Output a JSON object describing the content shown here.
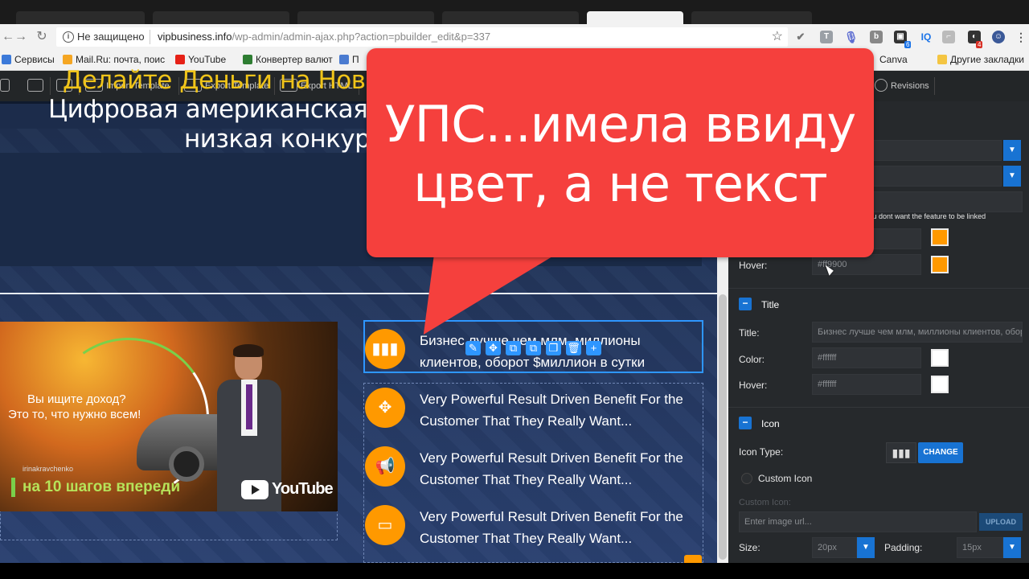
{
  "browser": {
    "security_label": "Не защищено",
    "url_domain": "vipbusiness.info",
    "url_path": "/wp-admin/admin-ajax.php?action=pbuilder_edit&p=337",
    "bookmarks": [
      "Сервисы",
      "Mail.Ru: почта, поис",
      "YouTube",
      "Конвертер валют",
      "П",
      "Canva",
      "Другие закладки"
    ],
    "badges": {
      "ext_badge_1": "6",
      "ext_badge_2": "4"
    }
  },
  "toolbar": {
    "items": [
      "Import Template",
      "Export Template",
      "Export HTML",
      "Revisions"
    ]
  },
  "canvas": {
    "headline1": "Делайте Деньги на Новинка",
    "headline2": "Цифровая американская пла",
    "headline3": "низкая конкурен",
    "video": {
      "question1": "Вы ищите доход?",
      "question2": "Это то, что нужно всем!",
      "author": "irinakravchenko",
      "cta": "на 10 шагов впереди",
      "platform": "YouTube"
    },
    "features": [
      {
        "icon": "chart-bars-icon",
        "text": "Бизнес лучше чем млм, миллионы клиентов, оборот $миллион в сутки"
      },
      {
        "icon": "move-arrows-icon",
        "text": "Very Powerful Result Driven Benefit For the Customer That They Really Want..."
      },
      {
        "icon": "megaphone-icon",
        "text": "Very Powerful Result Driven Benefit For the Customer That They Really Want..."
      },
      {
        "icon": "monitor-icon",
        "text": "Very Powerful Result Driven Benefit For the Customer That They Really Want..."
      }
    ]
  },
  "panel": {
    "link_hint": "you dont want the feature to be linked",
    "hover_label": "Hover:",
    "hover_value": "#ff9900",
    "title_section": "Title",
    "title_label": "Title:",
    "title_value": "Бизнес лучше чем млм, миллионы клиентов, оборо",
    "color_label": "Color:",
    "color_value": "#ffffff",
    "title_hover_label": "Hover:",
    "title_hover_value": "#ffffff",
    "icon_section": "Icon",
    "icon_type_label": "Icon Type:",
    "change_label": "CHANGE",
    "custom_icon_toggle": "Custom Icon",
    "custom_icon_label": "Custom Icon:",
    "image_url_placeholder": "Enter image url...",
    "upload_label": "UPLOAD",
    "size_label": "Size:",
    "size_value": "20px",
    "padding_label": "Padding:",
    "padding_value": "15px"
  },
  "callout": {
    "line1": "УПС...имела ввиду",
    "line2": "цвет, а не текст"
  },
  "colors": {
    "accent_orange": "#ff9900",
    "callout_red": "#f5403d",
    "select_blue": "#1873d3",
    "headline_yellow": "#f0c419"
  }
}
